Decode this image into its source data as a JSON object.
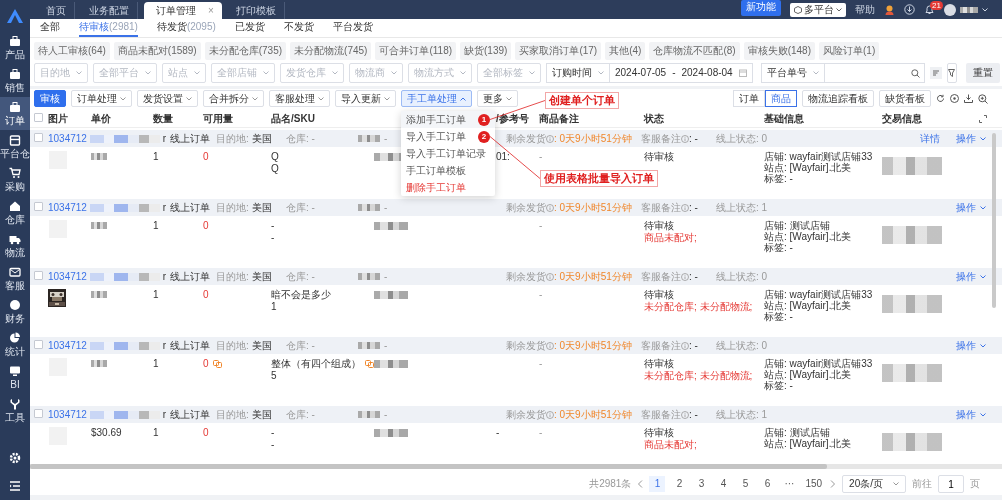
{
  "sidebar": {
    "items": [
      {
        "label": "产品",
        "selected": false
      },
      {
        "label": "销售",
        "selected": false
      },
      {
        "label": "订单",
        "selected": true
      },
      {
        "label": "平台仓",
        "selected": false
      },
      {
        "label": "采购",
        "selected": false
      },
      {
        "label": "仓库",
        "selected": false
      },
      {
        "label": "物流",
        "selected": false
      },
      {
        "label": "客服",
        "selected": false
      },
      {
        "label": "财务",
        "selected": false
      },
      {
        "label": "统计",
        "selected": false
      },
      {
        "label": "BI",
        "selected": false
      },
      {
        "label": "工具",
        "selected": false
      }
    ]
  },
  "top_tabs": [
    {
      "label": "首页",
      "selected": false
    },
    {
      "label": "业务配置",
      "selected": false
    },
    {
      "label": "订单管理",
      "selected": true,
      "close": "×"
    },
    {
      "label": "打印模板",
      "selected": false
    }
  ],
  "header": {
    "new_feature": "新功能",
    "platform": "多平台",
    "help": "帮助",
    "notifications": "21"
  },
  "status_tabs": [
    {
      "label": "全部",
      "selected": false
    },
    {
      "label": "待审核",
      "count": "(2981)",
      "selected": true
    },
    {
      "label": "待发货",
      "count": "(2095)",
      "selected": false
    },
    {
      "label": "已发货",
      "selected": false
    },
    {
      "label": "不发货",
      "selected": false
    },
    {
      "label": "平台发货",
      "selected": false
    }
  ],
  "quick_filters": [
    "待人工审核(64)",
    "商品未配对(1589)",
    "未分配仓库(735)",
    "未分配物流(745)",
    "可合并订单(118)",
    "缺货(139)",
    "买家取消订单(17)",
    "其他(4)",
    "仓库物流不匹配(8)",
    "审核失败(148)",
    "风险订单(1)"
  ],
  "filters": {
    "selects": [
      "目的地",
      "全部平台",
      "站点",
      "全部店铺",
      "发货仓库",
      "物流商",
      "物流方式",
      "全部标签"
    ],
    "time_field": "订购时间",
    "date_start": "2024-07-05",
    "date_separator": "-",
    "date_end": "2024-08-04",
    "search_field": "平台单号",
    "reset": "重置"
  },
  "toolbar": {
    "actions": [
      {
        "label": "审核",
        "kind": "primary"
      },
      {
        "label": "订单处理",
        "kind": "dropdown",
        "expanded": false
      },
      {
        "label": "发货设置",
        "kind": "dropdown",
        "expanded": false
      },
      {
        "label": "合并拆分",
        "kind": "dropdown",
        "expanded": false
      },
      {
        "label": "客服处理",
        "kind": "dropdown",
        "expanded": false
      },
      {
        "label": "导入更新",
        "kind": "dropdown",
        "expanded": false
      },
      {
        "label": "手工单处理",
        "kind": "dropdown",
        "expanded": true
      },
      {
        "label": "更多",
        "kind": "dropdown",
        "expanded": false
      }
    ],
    "views": [
      {
        "label": "订单",
        "selected": false
      },
      {
        "label": "商品",
        "selected": true
      }
    ],
    "boards": [
      "物流追踪看板",
      "缺货看板"
    ]
  },
  "menu": {
    "items": [
      {
        "label": "添加手工订单",
        "danger": false,
        "selected": true,
        "step": "1"
      },
      {
        "label": "导入手工订单",
        "danger": false,
        "selected": false,
        "step": "2"
      },
      {
        "label": "导入手工订单记录",
        "danger": false,
        "selected": false
      },
      {
        "label": "手工订单模板",
        "danger": false,
        "selected": false
      },
      {
        "label": "删除手工订单",
        "danger": true,
        "selected": false
      }
    ]
  },
  "annotations": [
    {
      "text": "创建单个订单"
    },
    {
      "text": "使用表格批量导入订单"
    }
  ],
  "table": {
    "all_checked": false,
    "columns": [
      "图片",
      "单价",
      "数量",
      "可用量",
      "品名/SKU",
      "/参考号",
      "商品备注",
      "状态",
      "基础信息",
      "交易信息"
    ],
    "orders": [
      {
        "id": "1034712",
        "suffix": "r",
        "channel": "线上订单",
        "destination_label": "目的地:",
        "destination": "美国",
        "warehouse": "仓库: -",
        "ref_summary": "-",
        "ship_left_label": "剩余发货",
        "ship_left": ": 0天9小时51分钟",
        "service_note_label": "客服备注",
        "service_note": ": -",
        "online_status": "线上状态: 0",
        "detail": "详情",
        "action": "操作",
        "checked": false,
        "image": {
          "kind": "placeholder"
        },
        "quantity": "1",
        "available": "0",
        "name_lines": [
          "Q",
          "Q"
        ],
        "ref_lines": [
          "01:"
        ],
        "remark": "-",
        "status": "待审核",
        "basic": [
          "店铺: wayfair测试店铺33",
          "站点: [Wayfair].北美",
          "标签: -"
        ]
      },
      {
        "id": "1034712",
        "suffix": "r",
        "channel": "线上订单",
        "destination_label": "目的地:",
        "destination": "美国",
        "warehouse": "仓库: -",
        "ref_summary": "-",
        "ship_left_label": "剩余发货",
        "ship_left": ": 0天9小时51分钟",
        "service_note_label": "客服备注",
        "service_note": ": -",
        "online_status": "线上状态: 1",
        "action": "操作",
        "checked": false,
        "image": {
          "kind": "placeholder"
        },
        "quantity": "1",
        "available": "0",
        "name_lines": [
          "-",
          "-"
        ],
        "remark": "-",
        "status": "待审核",
        "status_issue": "商品未配对;",
        "basic": [
          "店铺: 测试店铺",
          "站点: [Wayfair].北美",
          "标签: -"
        ]
      },
      {
        "id": "1034712",
        "suffix": "r",
        "channel": "线上订单",
        "destination_label": "目的地:",
        "destination": "美国",
        "warehouse": "仓库: -",
        "ref_summary": "-",
        "ship_left_label": "剩余发货",
        "ship_left": ": 0天9小时51分钟",
        "service_note_label": "客服备注",
        "service_note": ": -",
        "online_status": "线上状态: 0",
        "action": "操作",
        "checked": false,
        "image": {
          "kind": "picture"
        },
        "quantity": "1",
        "available": "0",
        "name_lines": [
          "暗不会是多少",
          "1"
        ],
        "remark": "-",
        "status": "待审核",
        "status_issue": "未分配仓库; 未分配物流;",
        "basic": [
          "店铺: wayfair测试店铺33",
          "站点: [Wayfair].北美",
          "标签: -"
        ]
      },
      {
        "id": "1034712",
        "suffix": "r",
        "channel": "线上订单",
        "destination_label": "目的地:",
        "destination": "美国",
        "warehouse": "仓库: -",
        "ref_summary": "-",
        "ship_left_label": "剩余发货",
        "ship_left": ": 0天9小时51分钟",
        "service_note_label": "客服备注",
        "service_note": ": -",
        "online_status": "线上状态: 0",
        "action": "操作",
        "checked": false,
        "image": {
          "kind": "placeholder"
        },
        "quantity": "1",
        "available": "0",
        "available_linked": true,
        "name_lines": [
          "整体（有四个组成）",
          "5"
        ],
        "name_linked": true,
        "remark": "-",
        "status": "待审核",
        "status_issue": "未分配仓库; 未分配物流;",
        "basic": [
          "店铺: wayfair测试店铺33",
          "站点: [Wayfair].北美",
          "标签: -"
        ]
      },
      {
        "id": "1034712",
        "suffix": "r",
        "channel": "线上订单",
        "destination_label": "目的地:",
        "destination": "美国",
        "warehouse": "仓库: -",
        "ref_summary": "-",
        "ship_left_label": "剩余发货",
        "ship_left": ": 0天9小时51分钟",
        "service_note_label": "客服备注",
        "service_note": ": -",
        "online_status": "线上状态: 1",
        "action": "操作",
        "checked": false,
        "image": {
          "kind": "placeholder"
        },
        "price": "$30.69",
        "quantity": "1",
        "available": "0",
        "name_lines": [
          "-",
          "-"
        ],
        "ref_lines": [
          "-"
        ],
        "remark": "-",
        "status": "待审核",
        "status_issue": "商品未配对;",
        "basic": [
          "店铺: 测试店铺",
          "站点: [Wayfair].北美"
        ]
      }
    ]
  },
  "pagination": {
    "total": "共2981条",
    "pages": [
      {
        "label": "1",
        "selected": true
      },
      {
        "label": "2",
        "selected": false
      },
      {
        "label": "3",
        "selected": false
      },
      {
        "label": "4",
        "selected": false
      },
      {
        "label": "5",
        "selected": false
      },
      {
        "label": "6",
        "selected": false
      },
      {
        "label": "···",
        "selected": false
      },
      {
        "label": "150",
        "selected": false
      }
    ],
    "page_size": "20条/页",
    "goto_label": "前往",
    "goto_value": "1",
    "goto_suffix": "页"
  }
}
